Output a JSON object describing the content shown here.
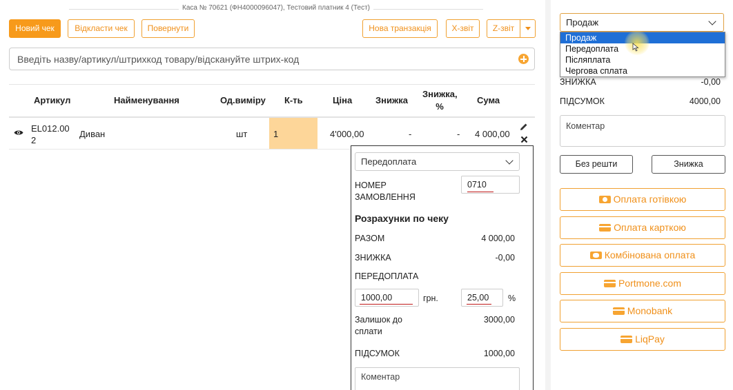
{
  "header": {
    "kasa_info": "Каса № 70621 (ФН4000096047), Тестовий платник 4 (Тест)"
  },
  "toolbar": {
    "new_check": "Новий чек",
    "postpone_check": "Відкласти чек",
    "return": "Повернути",
    "new_transaction": "Нова транзакція",
    "x_report": "X-звіт",
    "z_report": "Z-звіт"
  },
  "search": {
    "placeholder": "Введіть назву/артикул/штрихкод товару/відскануйте штрих-код"
  },
  "table": {
    "headers": {
      "article": "Артикул",
      "name": "Найменування",
      "unit": "Од.виміру",
      "qty": "К-ть",
      "price": "Ціна",
      "discount": "Знижка",
      "discount_pct_1": "Знижка,",
      "discount_pct_2": "%",
      "sum": "Сума"
    },
    "rows": [
      {
        "article_1": "EL012.00",
        "article_2": "2",
        "name": "Диван",
        "unit": "шт",
        "qty": "1",
        "price": "4'000,00",
        "discount": "-",
        "discount_pct": "-",
        "sum": "4 000,00"
      }
    ]
  },
  "popup": {
    "payment_type": "Передоплата",
    "order_number_label_1": "НОМЕР",
    "order_number_label_2": "ЗАМОВЛЕННЯ",
    "order_number": "0710",
    "section_title": "Розрахунки по чеку",
    "total_label": "РАЗОМ",
    "total_value": "4 000,00",
    "discount_label": "ЗНИЖКА",
    "discount_value": "-0,00",
    "prepay_label": "ПЕРЕДОПЛАТА",
    "prepay_amount": "1000,00",
    "currency": "грн.",
    "prepay_percent": "25,00",
    "percent_sign": "%",
    "remaining_label_1": "Залишок до",
    "remaining_label_2": "сплати",
    "remaining_value": "3000,00",
    "subtotal_label": "ПІДСУМОК",
    "subtotal_value": "1000,00",
    "comment_placeholder": "Коментар"
  },
  "right": {
    "operation_selected": "Продаж",
    "dropdown_options": [
      "Продаж",
      "Передоплата",
      "Післяплата",
      "Чергова сплата"
    ],
    "discount_label": "ЗНИЖКА",
    "discount_value": "-0,00",
    "subtotal_label": "ПІДСУМОК",
    "subtotal_value": "4000,00",
    "comment_placeholder": "Коментар",
    "no_change": "Без решти",
    "discount_button": "Знижка",
    "payments": {
      "cash": "Оплата готівкою",
      "card": "Оплата карткою",
      "combined": "Комбінована оплата",
      "portmone": "Portmone.com",
      "monobank": "Monobank",
      "liqpay": "LiqPay"
    }
  },
  "colors": {
    "accent": "#f79a1b",
    "qty_highlight": "#fdd699",
    "dropdown_selected": "#1f6fd6"
  }
}
